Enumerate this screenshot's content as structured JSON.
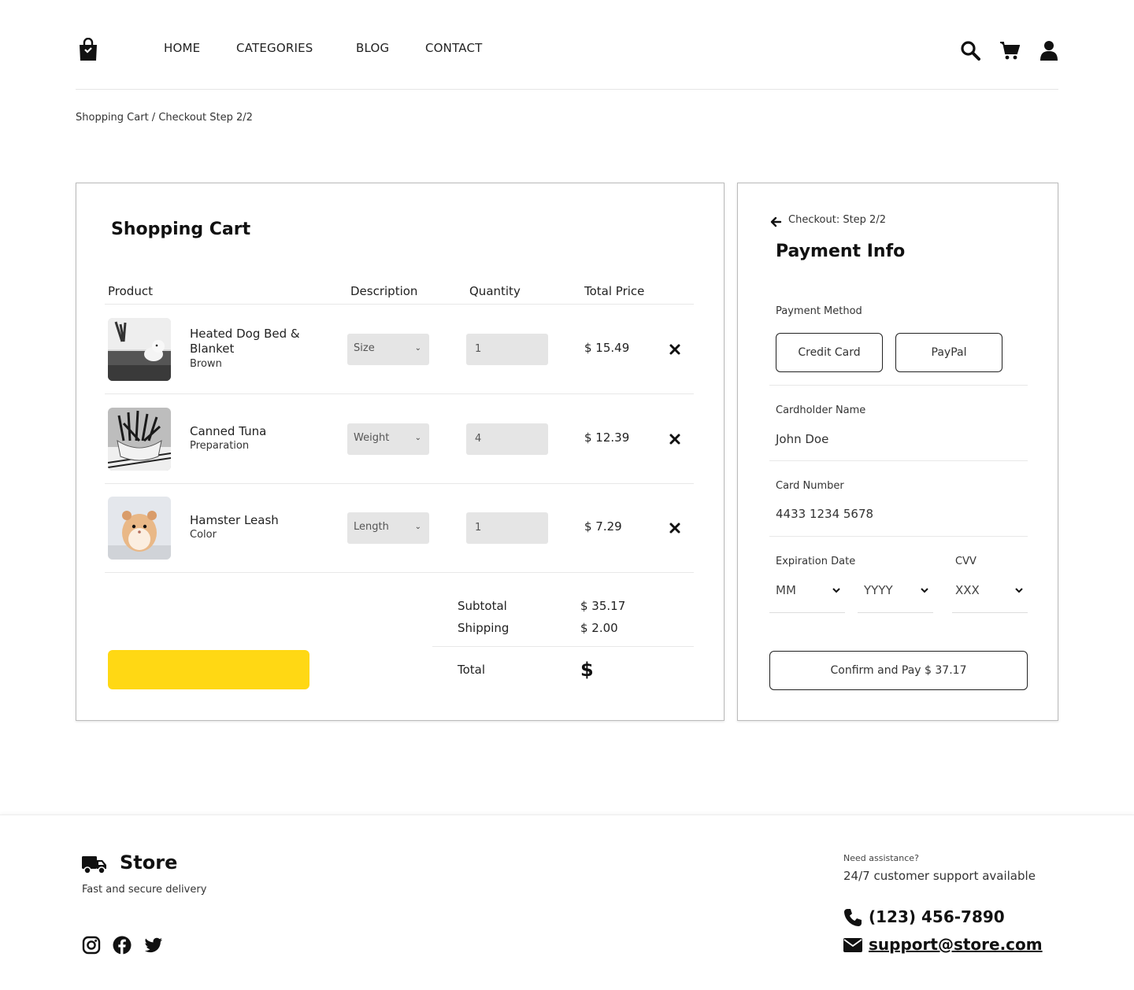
{
  "nav": {
    "items": [
      "HOME",
      "CATEGORIES",
      "BLOG",
      "CONTACT"
    ]
  },
  "breadcrumb": "Shopping Cart / Checkout Step 2/2",
  "cart": {
    "title": "Shopping Cart",
    "columns": [
      "Product",
      "Description",
      "Quantity",
      "Total Price"
    ],
    "items": [
      {
        "name": "Heated Dog Bed & Blanket",
        "variant": "Brown",
        "option": "Size",
        "qty": "1",
        "price": "$ 15.49"
      },
      {
        "name": "Canned Tuna",
        "variant": "Preparation",
        "option": "Weight",
        "qty": "4",
        "price": "$ 12.39"
      },
      {
        "name": "Hamster Leash",
        "variant": "Color",
        "option": "Length",
        "qty": "1",
        "price": "$ 7.29"
      }
    ],
    "subtotal_label": "Subtotal",
    "subtotal": "$ 35.17",
    "shipping_label": "Shipping",
    "shipping": "$ 2.00",
    "total_label": "Total",
    "total": "$"
  },
  "payment": {
    "step": "Checkout: Step 2/2",
    "title": "Payment Info",
    "method_label": "Payment Method",
    "methods": [
      "Credit Card",
      "PayPal"
    ],
    "cardholder_label": "Cardholder Name",
    "cardholder": "John Doe",
    "card_number_label": "Card Number",
    "card_number": "4433 1234 5678",
    "expiration_label": "Expiration Date",
    "cvv_label": "CVV",
    "month": "MM",
    "year": "YYYY",
    "cvv": "XXX",
    "confirm": "Confirm and Pay $ 37.17"
  },
  "footer": {
    "brand": "Store",
    "tagline": "Fast and secure delivery",
    "need": "Need assistance?",
    "support": "24/7 customer support available",
    "phone": "(123) 456-7890",
    "email": "support@store.com"
  },
  "colors": {
    "accent": "#FFD814",
    "text": "#222222",
    "border": "#BBBBBB",
    "input_bg": "#E5E5E5"
  }
}
